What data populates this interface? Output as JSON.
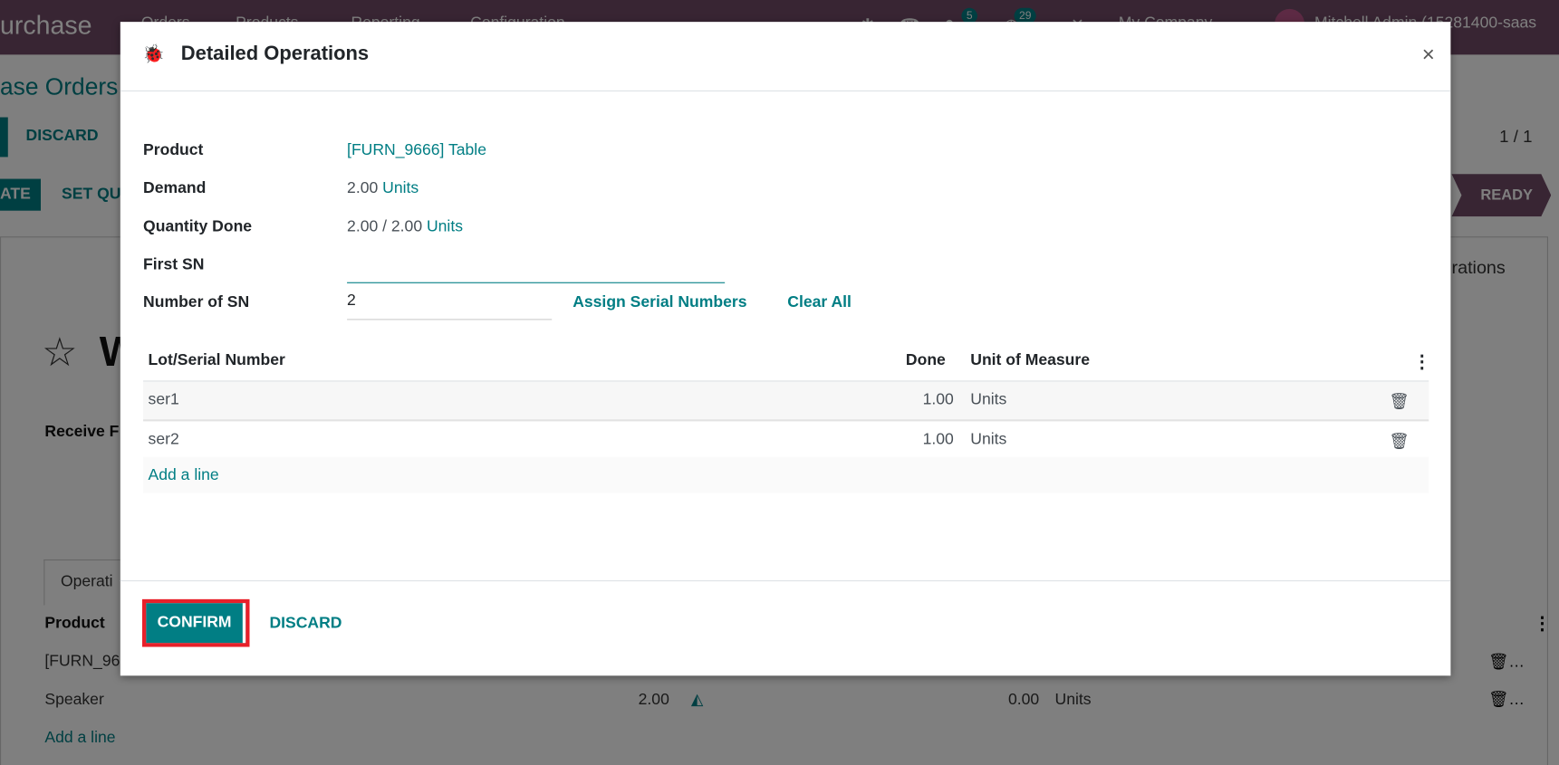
{
  "navbar": {
    "brand": "urchase",
    "menu": [
      "Orders",
      "Products",
      "Reporting",
      "Configuration"
    ],
    "chat_count": "5",
    "activity_count": "29",
    "company": "My Company",
    "user": "Mitchell Admin (15281400-saas"
  },
  "background": {
    "breadcrumb": "ase Orders",
    "discard": "DISCARD",
    "pager": "1 / 1",
    "validate": "ATE",
    "set_quantities": "SET QU",
    "status": "READY",
    "tab_ops": "rations",
    "title_initial": "W",
    "receive_label": "Receive F",
    "tab_operations": "Operati",
    "col_product": "Product",
    "rows": [
      {
        "product": "[FURN_96"
      },
      {
        "product": "Speaker",
        "qty": "2.00",
        "done": "0.00",
        "uom": "Units"
      }
    ],
    "add_line": "Add a line"
  },
  "modal": {
    "title": "Detailed Operations",
    "close": "×",
    "fields": {
      "product_label": "Product",
      "product_value": "[FURN_9666] Table",
      "demand_label": "Demand",
      "demand_value": "2.00",
      "demand_uom": "Units",
      "qty_done_label": "Quantity Done",
      "qty_done_value": "2.00",
      "qty_done_sep": "/",
      "qty_done_demand": "2.00",
      "qty_done_uom": "Units",
      "first_sn_label": "First SN",
      "first_sn_value": "",
      "number_sn_label": "Number of SN",
      "number_sn_value": "2",
      "assign": "Assign Serial Numbers",
      "clear_all": "Clear All"
    },
    "table": {
      "columns": [
        "Lot/Serial Number",
        "Done",
        "Unit of Measure"
      ],
      "rows": [
        {
          "lot": "ser1",
          "done": "1.00",
          "uom": "Units"
        },
        {
          "lot": "ser2",
          "done": "1.00",
          "uom": "Units"
        }
      ],
      "add_line": "Add a line"
    },
    "footer": {
      "confirm": "CONFIRM",
      "discard": "DISCARD"
    }
  },
  "colors": {
    "brand": "#714B67",
    "accent": "#017e84",
    "highlight": "#e8202a"
  }
}
